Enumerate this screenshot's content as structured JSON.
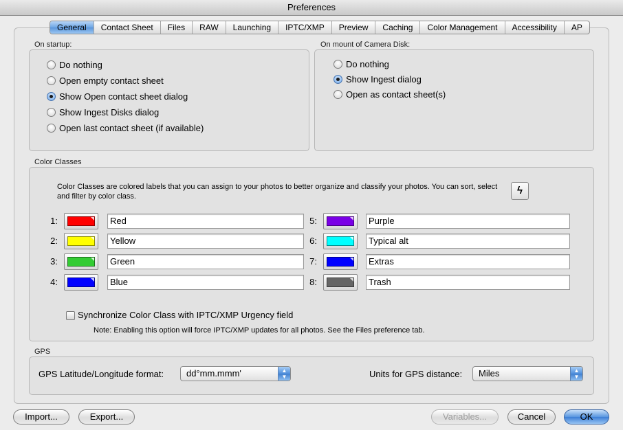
{
  "window": {
    "title": "Preferences"
  },
  "tabs": [
    "General",
    "Contact Sheet",
    "Files",
    "RAW",
    "Launching",
    "IPTC/XMP",
    "Preview",
    "Caching",
    "Color Management",
    "Accessibility",
    "AP"
  ],
  "startup": {
    "label": "On startup:",
    "options": [
      "Do nothing",
      "Open empty contact sheet",
      "Show Open contact sheet dialog",
      "Show Ingest Disks dialog",
      "Open last contact sheet (if available)"
    ],
    "selected_index": 2
  },
  "mount": {
    "label": "On mount of Camera Disk:",
    "options": [
      "Do nothing",
      "Show Ingest dialog",
      "Open as contact sheet(s)"
    ],
    "selected_index": 1
  },
  "color_classes": {
    "label": "Color Classes",
    "description": "Color Classes are colored labels that you can assign to your photos to better organize and classify your photos.  You can sort, select and filter by color class.",
    "bolt_icon": "lightning-bolt-icon",
    "items": [
      {
        "num": "1:",
        "name": "Red",
        "color": "#ff0000"
      },
      {
        "num": "2:",
        "name": "Yellow",
        "color": "#ffff00"
      },
      {
        "num": "3:",
        "name": "Green",
        "color": "#33cc33"
      },
      {
        "num": "4:",
        "name": "Blue",
        "color": "#0000ff"
      },
      {
        "num": "5:",
        "name": "Purple",
        "color": "#7a00e6"
      },
      {
        "num": "6:",
        "name": "Typical alt",
        "color": "#00ffff"
      },
      {
        "num": "7:",
        "name": "Extras",
        "color": "#0000ff"
      },
      {
        "num": "8:",
        "name": "Trash",
        "color": "#666666"
      }
    ],
    "sync_label": "Synchronize Color Class with IPTC/XMP Urgency field",
    "sync_checked": false,
    "note": "Note: Enabling this option will force IPTC/XMP updates for all photos. See the Files preference tab."
  },
  "gps": {
    "label": "GPS",
    "format_label": "GPS Latitude/Longitude format:",
    "format_value": "dd°mm.mmm'",
    "units_label": "Units for GPS distance:",
    "units_value": "Miles"
  },
  "buttons": {
    "import": "Import...",
    "export": "Export...",
    "variables": "Variables...",
    "cancel": "Cancel",
    "ok": "OK"
  }
}
